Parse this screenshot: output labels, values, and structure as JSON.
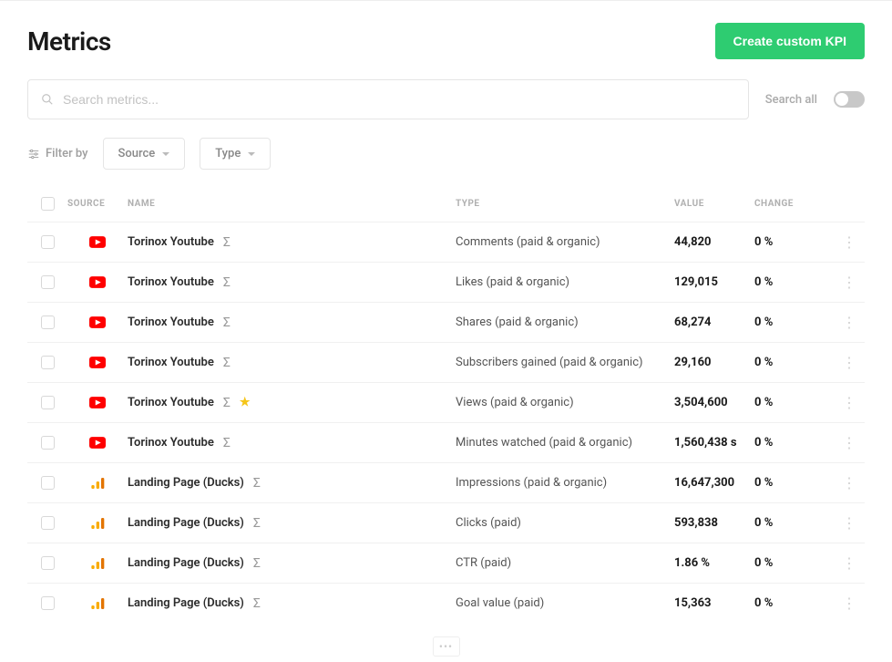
{
  "header": {
    "title": "Metrics",
    "create_button": "Create custom KPI"
  },
  "search": {
    "placeholder": "Search metrics...",
    "search_all_label": "Search all"
  },
  "filters": {
    "filter_by_label": "Filter by",
    "source_label": "Source",
    "type_label": "Type"
  },
  "table": {
    "headers": {
      "source": "SOURCE",
      "name": "NAME",
      "type": "TYPE",
      "value": "VALUE",
      "change": "CHANGE"
    },
    "rows": [
      {
        "source_icon": "youtube",
        "name": "Torinox Youtube",
        "has_sigma": true,
        "starred": false,
        "type": "Comments (paid & organic)",
        "value": "44,820",
        "change": "0 %"
      },
      {
        "source_icon": "youtube",
        "name": "Torinox Youtube",
        "has_sigma": true,
        "starred": false,
        "type": "Likes (paid & organic)",
        "value": "129,015",
        "change": "0 %"
      },
      {
        "source_icon": "youtube",
        "name": "Torinox Youtube",
        "has_sigma": true,
        "starred": false,
        "type": "Shares (paid & organic)",
        "value": "68,274",
        "change": "0 %"
      },
      {
        "source_icon": "youtube",
        "name": "Torinox Youtube",
        "has_sigma": true,
        "starred": false,
        "type": "Subscribers gained (paid & organic)",
        "value": "29,160",
        "change": "0 %"
      },
      {
        "source_icon": "youtube",
        "name": "Torinox Youtube",
        "has_sigma": true,
        "starred": true,
        "type": "Views (paid & organic)",
        "value": "3,504,600",
        "change": "0 %"
      },
      {
        "source_icon": "youtube",
        "name": "Torinox Youtube",
        "has_sigma": true,
        "starred": false,
        "type": "Minutes watched (paid & organic)",
        "value": "1,560,438 s",
        "change": "0 %"
      },
      {
        "source_icon": "analytics",
        "name": "Landing Page (Ducks)",
        "has_sigma": true,
        "starred": false,
        "type": "Impressions (paid & organic)",
        "value": "16,647,300",
        "change": "0 %"
      },
      {
        "source_icon": "analytics",
        "name": "Landing Page (Ducks)",
        "has_sigma": true,
        "starred": false,
        "type": "Clicks (paid)",
        "value": "593,838",
        "change": "0 %"
      },
      {
        "source_icon": "analytics",
        "name": "Landing Page (Ducks)",
        "has_sigma": true,
        "starred": false,
        "type": "CTR (paid)",
        "value": "1.86 %",
        "change": "0 %"
      },
      {
        "source_icon": "analytics",
        "name": "Landing Page (Ducks)",
        "has_sigma": true,
        "starred": false,
        "type": "Goal value (paid)",
        "value": "15,363",
        "change": "0 %"
      }
    ]
  }
}
